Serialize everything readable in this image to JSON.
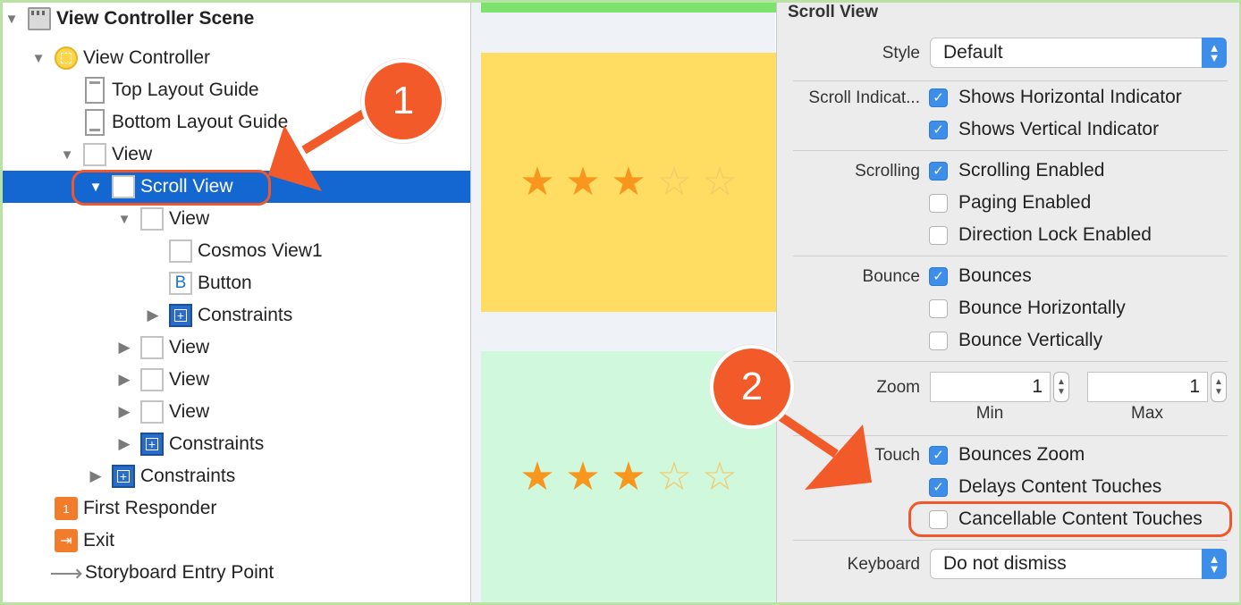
{
  "outline": {
    "items": [
      {
        "label": "View Controller Scene"
      },
      {
        "label": "View Controller"
      },
      {
        "label": "Top Layout Guide"
      },
      {
        "label": "Bottom Layout Guide"
      },
      {
        "label": "View"
      },
      {
        "label": "Scroll View"
      },
      {
        "label": "View"
      },
      {
        "label": "Cosmos View1"
      },
      {
        "label": "Button",
        "icon_text": "B"
      },
      {
        "label": "Constraints"
      },
      {
        "label": "View"
      },
      {
        "label": "View"
      },
      {
        "label": "View"
      },
      {
        "label": "Constraints"
      },
      {
        "label": "Constraints"
      },
      {
        "label": "First Responder"
      },
      {
        "label": "Exit"
      },
      {
        "label": "Storyboard Entry Point"
      }
    ]
  },
  "canvas": {
    "ratings": [
      {
        "filled": 3,
        "total": 5
      },
      {
        "filled": 3,
        "total": 5
      }
    ],
    "colors": {
      "yellow": "#ffdd62",
      "mint": "#cff8dd",
      "star": "#f9961e"
    }
  },
  "inspector": {
    "title": "Scroll View",
    "style": {
      "label": "Style",
      "value": "Default"
    },
    "scroll_indicators": {
      "label": "Scroll Indicat...",
      "options": [
        {
          "label": "Shows Horizontal Indicator",
          "checked": true
        },
        {
          "label": "Shows Vertical Indicator",
          "checked": true
        }
      ]
    },
    "scrolling": {
      "label": "Scrolling",
      "options": [
        {
          "label": "Scrolling Enabled",
          "checked": true
        },
        {
          "label": "Paging Enabled",
          "checked": false
        },
        {
          "label": "Direction Lock Enabled",
          "checked": false
        }
      ]
    },
    "bounce": {
      "label": "Bounce",
      "options": [
        {
          "label": "Bounces",
          "checked": true
        },
        {
          "label": "Bounce Horizontally",
          "checked": false
        },
        {
          "label": "Bounce Vertically",
          "checked": false
        }
      ]
    },
    "zoom": {
      "label": "Zoom",
      "min": "1",
      "max": "1",
      "min_label": "Min",
      "max_label": "Max"
    },
    "touch": {
      "label": "Touch",
      "options": [
        {
          "label": "Bounces Zoom",
          "checked": true
        },
        {
          "label": "Delays Content Touches",
          "checked": true
        },
        {
          "label": "Cancellable Content Touches",
          "checked": false
        }
      ]
    },
    "keyboard": {
      "label": "Keyboard",
      "value": "Do not dismiss"
    },
    "accent": "#3c8ee8"
  },
  "annotations": {
    "badge1": "1",
    "badge2": "2",
    "color": "#f25a29"
  }
}
